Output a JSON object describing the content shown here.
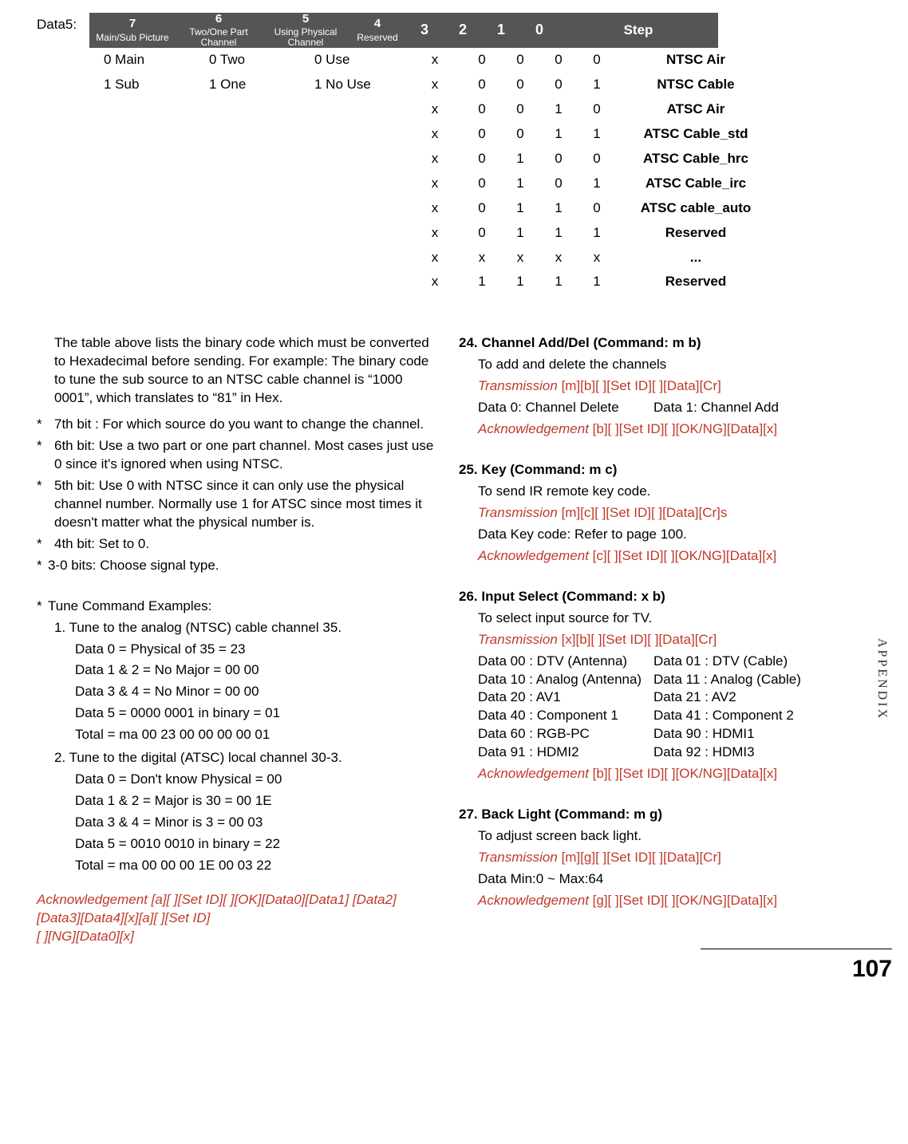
{
  "data5_label": "Data5:",
  "table": {
    "headers": {
      "b7_num": "7",
      "b7_txt": "Main/Sub Picture",
      "b6_num": "6",
      "b6_txt": "Two/One Part Channel",
      "b5_num": "5",
      "b5_txt": "Using Physical Channel",
      "b4_num": "4",
      "b4_txt": "Reserved",
      "b3": "3",
      "b2": "2",
      "b1": "1",
      "b0": "0",
      "step": "Step"
    },
    "pairs7": [
      "0   Main",
      "1   Sub"
    ],
    "pairs6": [
      "0   Two",
      "1   One"
    ],
    "pairs5": [
      "0   Use",
      "1   No Use"
    ],
    "rows": [
      {
        "b4": "x",
        "b3": "0",
        "b2": "0",
        "b1": "0",
        "b0": "0",
        "step": "NTSC Air"
      },
      {
        "b4": "x",
        "b3": "0",
        "b2": "0",
        "b1": "0",
        "b0": "1",
        "step": "NTSC Cable"
      },
      {
        "b4": "x",
        "b3": "0",
        "b2": "0",
        "b1": "1",
        "b0": "0",
        "step": "ATSC Air"
      },
      {
        "b4": "x",
        "b3": "0",
        "b2": "0",
        "b1": "1",
        "b0": "1",
        "step": "ATSC Cable_std"
      },
      {
        "b4": "x",
        "b3": "0",
        "b2": "1",
        "b1": "0",
        "b0": "0",
        "step": "ATSC Cable_hrc"
      },
      {
        "b4": "x",
        "b3": "0",
        "b2": "1",
        "b1": "0",
        "b0": "1",
        "step": "ATSC Cable_irc"
      },
      {
        "b4": "x",
        "b3": "0",
        "b2": "1",
        "b1": "1",
        "b0": "0",
        "step": "ATSC cable_auto"
      },
      {
        "b4": "x",
        "b3": "0",
        "b2": "1",
        "b1": "1",
        "b0": "1",
        "step": "Reserved"
      },
      {
        "b4": "x",
        "b3": "x",
        "b2": "x",
        "b1": "x",
        "b0": "x",
        "step": "..."
      },
      {
        "b4": "x",
        "b3": "1",
        "b2": "1",
        "b1": "1",
        "b0": "1",
        "step": "Reserved"
      }
    ]
  },
  "left": {
    "intro": "The table above lists the binary code which must be converted to Hexadecimal before sending. For example: The binary code to tune the sub source to an NTSC cable channel is “1000 0001”, which translates to “81” in Hex.",
    "n7": "7th bit : For which source do you want to change the channel.",
    "n6": "6th bit: Use a two part or one part channel. Most cases just use 0 since it's ignored when using NTSC.",
    "n5": "5th bit: Use 0 with NTSC since it can only use the physical channel number. Normally use 1 for ATSC since most times it doesn't  matter what the physical number is.",
    "n4": "4th bit: Set to 0.",
    "n30": "3-0 bits: Choose signal type.",
    "tune_hdr": "Tune Command Examples:",
    "ex1_hdr": "1. Tune to the analog (NTSC) cable channel 35.",
    "ex1": [
      "Data  0 = Physical of 35 = 23",
      "Data 1 & 2 = No Major = 00 00",
      "Data 3 & 4 = No Minor = 00 00",
      "Data 5 = 0000 0001 in binary = 01",
      "Total = ma 00 23 00 00 00 00 01"
    ],
    "ex2_hdr": "2. Tune to the digital (ATSC) local channel 30-3.",
    "ex2": [
      "Data  0 = Don't know Physical = 00",
      "Data 1 & 2 = Major is 30 = 00 1E",
      "Data 3 & 4 = Minor is 3 = 00 03",
      "Data 5 = 0010 0010 in binary = 22",
      "Total = ma 00 00 00 1E 00 03 22"
    ],
    "ack_lbl": "Acknowledgement",
    "ack_body1": "[a][ ][Set ID][ ][OK][Data0][Data1] [Data2][Data3][Data4][x][a][ ][Set ID]",
    "ack_body2": "[ ][NG][Data0][x]"
  },
  "cmds": {
    "c24": {
      "title": "24. Channel Add/Del (Command: m b)",
      "desc": "To add and delete the channels",
      "trans_lbl": "Transmission",
      "trans": "[m][b][  ][Set ID][  ][Data][Cr]",
      "data_l": "Data 0: Channel Delete",
      "data_r": "Data 1: Channel Add",
      "ack_lbl": "Acknowledgement",
      "ack": "[b][  ][Set ID][  ][OK/NG][Data][x]"
    },
    "c25": {
      "title": "25. Key (Command: m c)",
      "desc": " To send IR remote key code.",
      "trans_lbl": "Transmission",
      "trans": "[m][c][  ][Set ID][  ][Data][Cr]s",
      "data": "Data Key code: Refer to page 100.",
      "ack_lbl": "Acknowledgement",
      "ack": "[c][  ][Set ID][  ][OK/NG][Data][x]"
    },
    "c26": {
      "title": "26. Input Select (Command: x b)",
      "desc": " To select input source for TV.",
      "trans_lbl": "Transmission",
      "trans": "[x][b][  ][Set ID][  ][Data][Cr]",
      "rows": [
        {
          "l": "Data 00 : DTV (Antenna)",
          "r": "Data 01 : DTV (Cable)"
        },
        {
          "l": "Data 10 : Analog (Antenna)",
          "r": "Data 11 : Analog (Cable)"
        },
        {
          "l": "Data 20 : AV1",
          "r": "Data 21 : AV2"
        },
        {
          "l": "Data 40 : Component 1",
          "r": "Data 41 : Component 2"
        },
        {
          "l": "Data 60 : RGB-PC",
          "r": "Data 90 : HDMI1"
        },
        {
          "l": "Data 91 : HDMI2",
          "r": "Data 92 : HDMI3"
        }
      ],
      "ack_lbl": "Acknowledgement",
      "ack": "[b][  ][Set ID][  ][OK/NG][Data][x]"
    },
    "c27": {
      "title": "27. Back Light (Command: m g)",
      "desc": " To adjust screen back light.",
      "trans_lbl": "Transmission",
      "trans": "[m][g][  ][Set ID][  ][Data][Cr]",
      "data": "Data Min:0 ~ Max:64",
      "ack_lbl": "Acknowledgement",
      "ack": "[g][  ][Set ID][  ][OK/NG][Data][x]"
    }
  },
  "side_tab": "APPENDIX",
  "page_num": "107"
}
